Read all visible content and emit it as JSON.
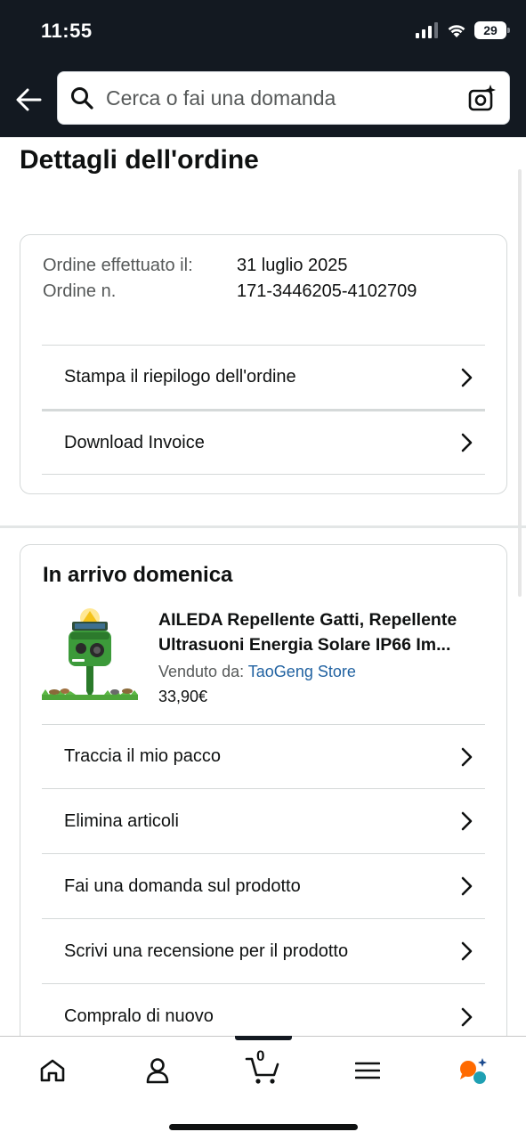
{
  "status_bar": {
    "time": "11:55",
    "battery": "29"
  },
  "header": {
    "back_icon": "arrow-left-icon",
    "search_placeholder": "Cerca o fai una domanda",
    "camera_icon": "camera-sparkle-icon"
  },
  "page": {
    "title": "Dettagli dell'ordine"
  },
  "order_summary": {
    "placed_label": "Ordine effettuato il:",
    "placed_value": "31 luglio 2025",
    "number_label": "Ordine n.",
    "number_value": "171-3446205-4102709",
    "actions": [
      {
        "label": "Stampa il riepilogo dell'ordine"
      },
      {
        "label": "Download Invoice"
      }
    ]
  },
  "shipment": {
    "title": "In arrivo domenica",
    "product": {
      "name": "AILEDA Repellente Gatti, Repellente Ultrasuoni Energia Solare IP66 Im...",
      "seller_label": "Venduto da:",
      "seller_name": "TaoGeng Store",
      "price": "33,90€"
    },
    "actions": [
      {
        "label": "Traccia il mio pacco"
      },
      {
        "label": "Elimina articoli"
      },
      {
        "label": "Fai una domanda sul prodotto"
      },
      {
        "label": "Scrivi una recensione per il prodotto"
      },
      {
        "label": "Compralo di nuovo"
      }
    ]
  },
  "bottom_nav": {
    "items": [
      "home-icon",
      "account-icon",
      "cart-icon",
      "menu-icon",
      "rufus-assistant-icon"
    ],
    "cart_count": "0"
  },
  "colors": {
    "header_bg": "#131921",
    "link": "#2162a1",
    "text": "#0f1111",
    "muted": "#565959"
  }
}
